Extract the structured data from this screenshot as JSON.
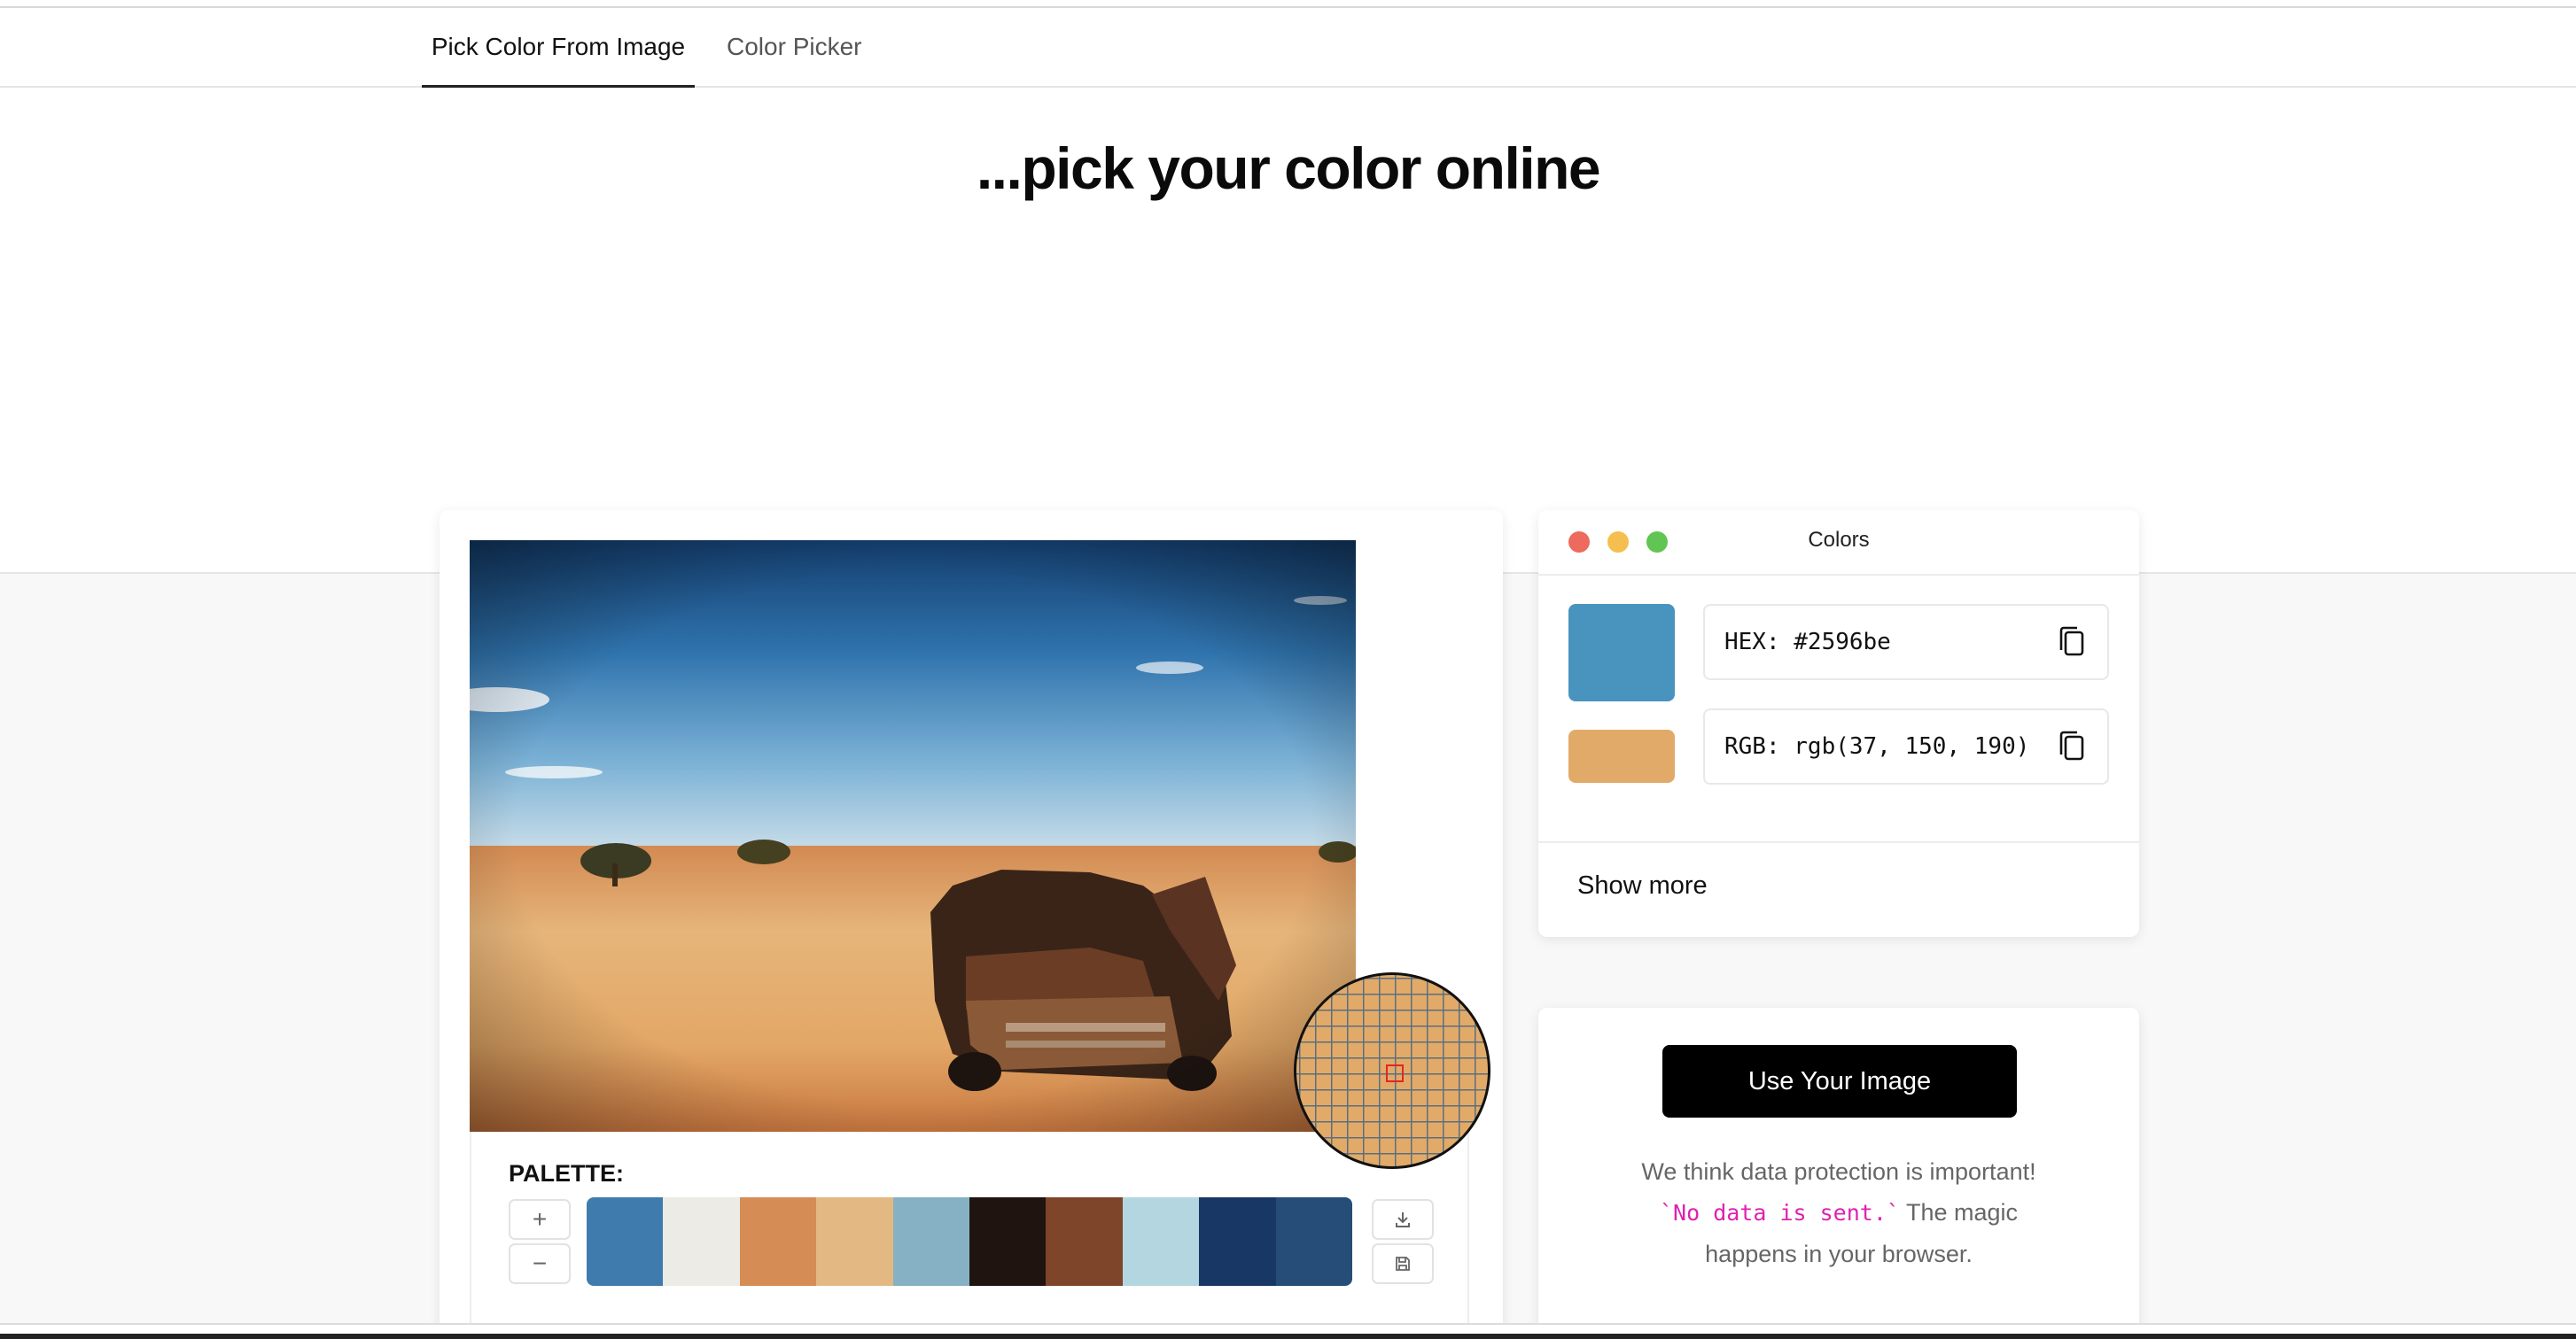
{
  "tabs": [
    {
      "label": "Pick Color From Image",
      "active": true
    },
    {
      "label": "Color Picker",
      "active": false
    }
  ],
  "headline": "...pick your color online",
  "image_panel": {
    "palette_label": "PALETTE:",
    "add_label": "+",
    "remove_label": "−",
    "palette": [
      "#3f7cad",
      "#ecebe6",
      "#d58c55",
      "#e4b883",
      "#86b1c4",
      "#1f1410",
      "#7e452b",
      "#b4d6e0",
      "#183764",
      "#264d78"
    ],
    "magnifier_color": "#e2aa68"
  },
  "colors_panel": {
    "title": "Colors",
    "window_dots": [
      "#ed6a5e",
      "#f5bf4f",
      "#61c554"
    ],
    "primary_swatch": "#4894bf",
    "secondary_swatch": "#e2aa68",
    "hex_text": "HEX: #2596be",
    "rgb_text": "RGB: rgb(37, 150, 190)",
    "show_more": "Show more"
  },
  "upload_panel": {
    "button_label": "Use Your Image",
    "protection_line1": "We think data protection is important!",
    "protection_code": "`No data is sent.`",
    "protection_line2_rest": " The magic",
    "protection_line3": "happens in your browser."
  }
}
